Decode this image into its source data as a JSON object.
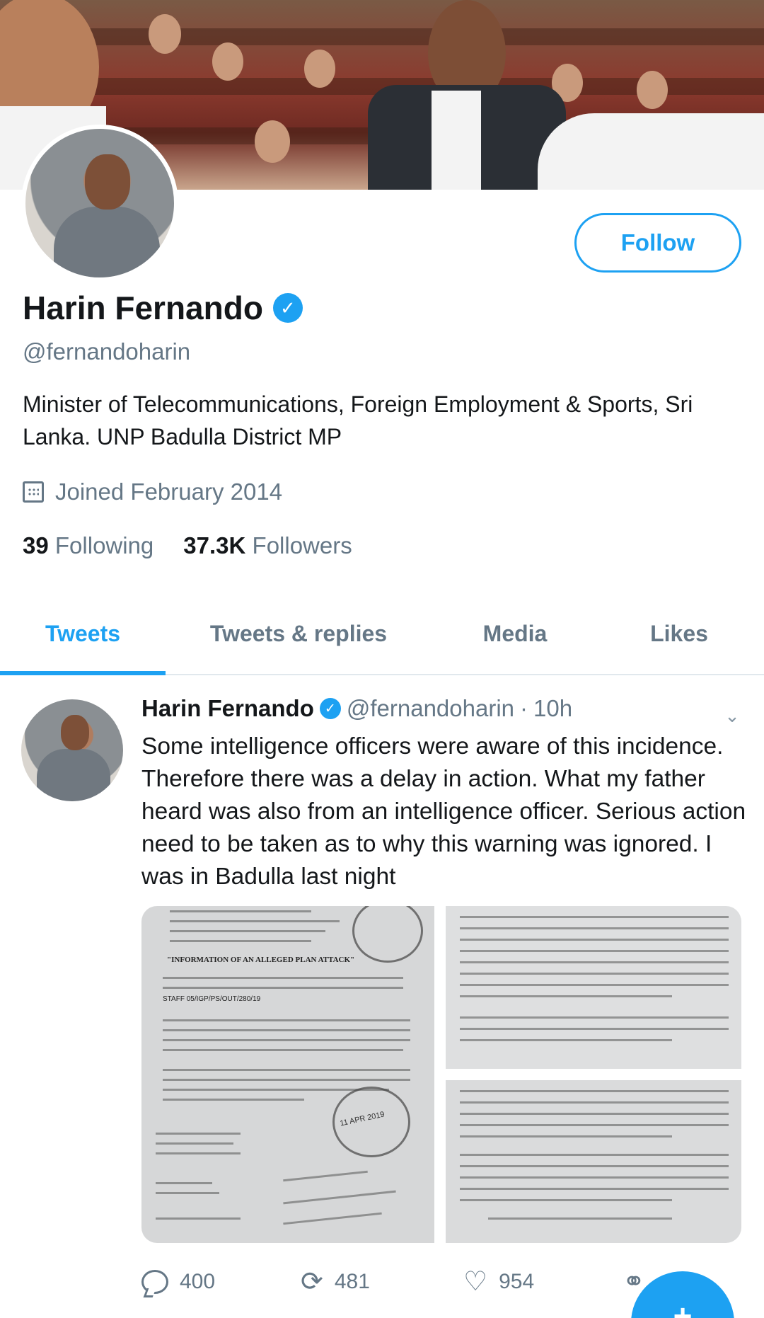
{
  "profile": {
    "name": "Harin Fernando",
    "verified_icon": "verified-badge-icon",
    "handle": "@fernandoharin",
    "bio": "Minister of Telecommunications, Foreign Employment  & Sports, Sri Lanka. UNP Badulla District MP",
    "joined": "Joined February 2014",
    "following_count": "39",
    "following_label": "Following",
    "followers_count": "37.3K",
    "followers_label": "Followers",
    "follow_button": "Follow"
  },
  "tabs": [
    {
      "label": "Tweets",
      "active": true
    },
    {
      "label": "Tweets & replies",
      "active": false
    },
    {
      "label": "Media",
      "active": false
    },
    {
      "label": "Likes",
      "active": false
    }
  ],
  "tweet": {
    "name": "Harin Fernando",
    "handle": "@fernandoharin",
    "dot": "·",
    "time": "10h",
    "text": "Some intelligence officers were aware of this incidence. Therefore there was a delay in action. What my father heard was also from an intelligence officer. Serious action need to be taken as to why this warning was ignored. I was in Badulla last night",
    "media_doc_heading": "\"INFORMATION OF AN ALLEGED PLAN ATTACK\"",
    "media_doc_ref": "STAFF 05/IGP/PS/OUT/280/19",
    "media_stamp_text": "11 APR 2019",
    "replies": "400",
    "retweets": "481",
    "likes": "954"
  },
  "colors": {
    "accent": "#1da1f2",
    "secondary_text": "#657786",
    "primary_text": "#14171a"
  }
}
